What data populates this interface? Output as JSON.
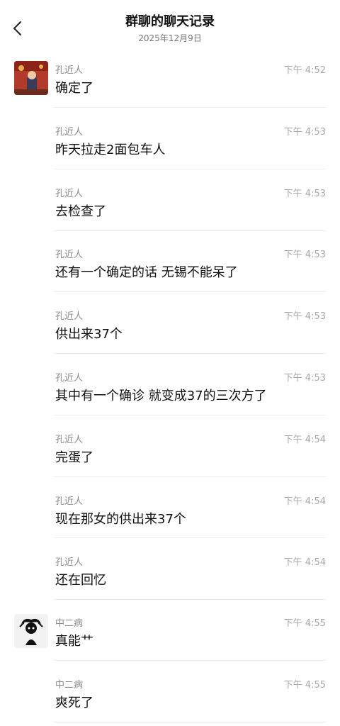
{
  "header": {
    "back_icon": "chevron-left-icon",
    "title": "群聊的聊天记录",
    "date": "2025年12月9日"
  },
  "messages": [
    {
      "sender": "孔近人",
      "time": "下午 4:52",
      "text": "确定了",
      "avatar": "photo-avatar"
    },
    {
      "sender": "孔近人",
      "time": "下午 4:53",
      "text": "昨天拉走2面包车人"
    },
    {
      "sender": "孔近人",
      "time": "下午 4:53",
      "text": "去检查了"
    },
    {
      "sender": "孔近人",
      "time": "下午 4:53",
      "text": "还有一个确定的话 无锡不能呆了"
    },
    {
      "sender": "孔近人",
      "time": "下午 4:53",
      "text": "供出来37个"
    },
    {
      "sender": "孔近人",
      "time": "下午 4:53",
      "text": "其中有一个确诊 就变成37的三次方了"
    },
    {
      "sender": "孔近人",
      "time": "下午 4:54",
      "text": "完蛋了"
    },
    {
      "sender": "孔近人",
      "time": "下午 4:54",
      "text": "现在那女的供出来37个"
    },
    {
      "sender": "孔近人",
      "time": "下午 4:54",
      "text": "还在回忆"
    },
    {
      "sender": "中二病",
      "time": "下午 4:55",
      "text": "真能艹",
      "avatar": "cartoon-avatar"
    },
    {
      "sender": "中二病",
      "time": "下午 4:55",
      "text": "爽死了"
    }
  ]
}
